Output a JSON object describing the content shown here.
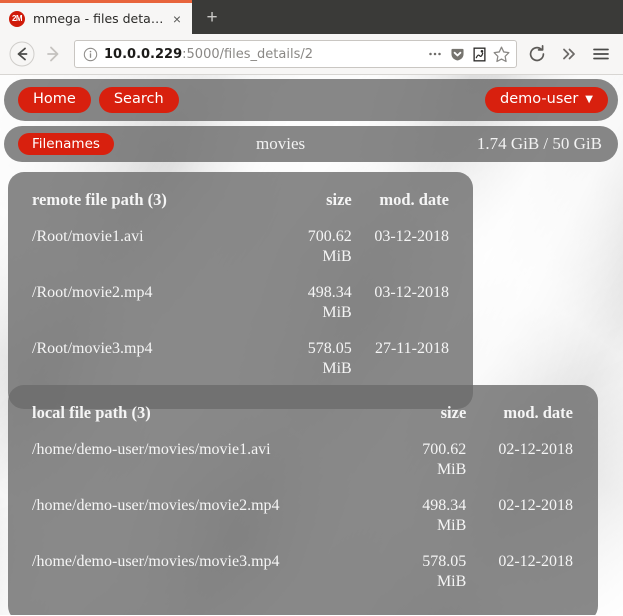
{
  "browser": {
    "tab": {
      "title": "mmega - files details",
      "favicon_label": "2M",
      "favicon_name": "mmega-logo-icon",
      "close_label": "×"
    },
    "new_tab_label": "+",
    "toolbar": {
      "back_label": "back-arrow",
      "forward_label": "forward-arrow",
      "reload_label": "reload-arrow",
      "overflow_label": "»",
      "menu_label": "hamburger-menu"
    },
    "url_bar": {
      "host": "10.0.0.229",
      "path": ":5000/files_details/2",
      "full_url": "10.0.0.229:5000/files_details/2",
      "info_icon": "page-info-icon",
      "ellipsis_label": "…",
      "pocket_icon": "pocket-icon",
      "reader_icon": "reader-view-icon",
      "bookmark_icon": "star-icon"
    }
  },
  "theme": {
    "accent_red": "#d8200e",
    "panel_gray": "rgba(108,108,108,0.80)",
    "text_light": "#f5f5f5",
    "tab_accent": "#e8643c"
  },
  "nav": {
    "home_label": "Home",
    "search_label": "Search",
    "user_label": "demo-user",
    "user_caret": "▼",
    "filenames_label": "Filenames",
    "folder_title": "movies",
    "quota": "1.74 GiB / 50 GiB"
  },
  "tables": [
    {
      "id": "remote",
      "headers": {
        "path": "remote file path (3)",
        "size": "size",
        "date": "mod. date"
      },
      "rows": [
        {
          "path": "/Root/movie1.avi",
          "size": "700.62",
          "unit": "MiB",
          "date": "03-12-2018"
        },
        {
          "path": "/Root/movie2.mp4",
          "size": "498.34",
          "unit": "MiB",
          "date": "03-12-2018"
        },
        {
          "path": "/Root/movie3.mp4",
          "size": "578.05",
          "unit": "MiB",
          "date": "27-11-2018"
        }
      ]
    },
    {
      "id": "local",
      "headers": {
        "path": "local file path (3)",
        "size": "size",
        "date": "mod. date"
      },
      "rows": [
        {
          "path": "/home/demo-user/movies/movie1.avi",
          "size": "700.62",
          "unit": "MiB",
          "date": "02-12-2018"
        },
        {
          "path": "/home/demo-user/movies/movie2.mp4",
          "size": "498.34",
          "unit": "MiB",
          "date": "02-12-2018"
        },
        {
          "path": "/home/demo-user/movies/movie3.mp4",
          "size": "578.05",
          "unit": "MiB",
          "date": "02-12-2018"
        }
      ]
    }
  ]
}
